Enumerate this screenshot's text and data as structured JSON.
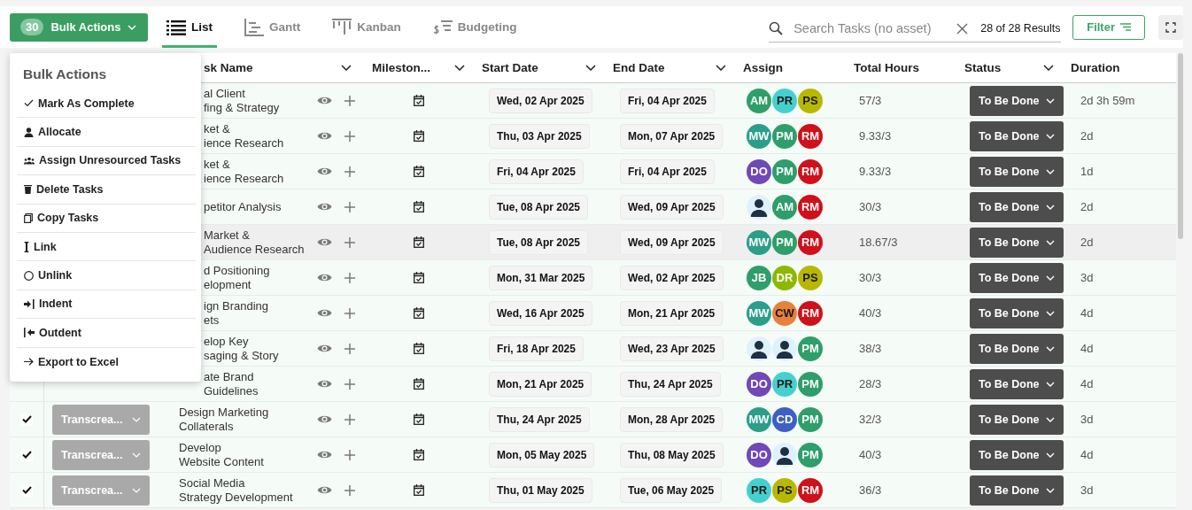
{
  "toolbar": {
    "bulk_actions": {
      "count": "30",
      "label": "Bulk Actions"
    },
    "tabs": [
      {
        "label": "List",
        "selected": true
      },
      {
        "label": "Gantt",
        "selected": false
      },
      {
        "label": "Kanban",
        "selected": false
      },
      {
        "label": "Budgeting",
        "selected": false
      }
    ],
    "search": {
      "placeholder": "Search Tasks (no asset)"
    },
    "results": "28 of 28 Results",
    "filter": "Filter"
  },
  "table": {
    "columns": [
      {
        "label": "sk Name",
        "menu": true
      },
      {
        "label": "Mileston...",
        "menu": true
      },
      {
        "label": "Start Date",
        "menu": true
      },
      {
        "label": "End Date",
        "menu": true
      },
      {
        "label": "Assign",
        "menu": false
      },
      {
        "label": "Total Hours",
        "menu": false
      },
      {
        "label": "Status",
        "menu": true
      },
      {
        "label": "Duration",
        "menu": false
      }
    ],
    "rows": [
      {
        "name": [
          "al Client",
          "fing & Strategy"
        ],
        "start": "Wed, 02 Apr 2025",
        "end": "Fri, 04 Apr 2025",
        "assign": [
          {
            "initials": "AM",
            "color": "#2e9e6a"
          },
          {
            "initials": "PR",
            "color": "#45d0d0"
          },
          {
            "initials": "PS",
            "color": "#b8b800"
          }
        ],
        "hours": "57/3",
        "status": "To Be Done",
        "duration": "2d 3h 59m",
        "highlighted": false
      },
      {
        "name": [
          "ket &",
          "ience Research"
        ],
        "start": "Thu, 03 Apr 2025",
        "end": "Mon, 07 Apr 2025",
        "assign": [
          {
            "initials": "MW",
            "color": "#2b9e8a"
          },
          {
            "initials": "PM",
            "color": "#2e9e6a"
          },
          {
            "initials": "RM",
            "color": "#d0101a"
          }
        ],
        "hours": "9.33/3",
        "status": "To Be Done",
        "duration": "2d",
        "highlighted": false
      },
      {
        "name": [
          "ket &",
          "ience Research"
        ],
        "start": "Fri, 04 Apr 2025",
        "end": "Fri, 04 Apr 2025",
        "assign": [
          {
            "initials": "DO",
            "color": "#7048b8"
          },
          {
            "initials": "PM",
            "color": "#2e9e6a"
          },
          {
            "initials": "RM",
            "color": "#d0101a"
          }
        ],
        "hours": "9.33/3",
        "status": "To Be Done",
        "duration": "1d",
        "highlighted": false
      },
      {
        "name": [
          "petitor Analysis"
        ],
        "start": "Tue, 08 Apr 2025",
        "end": "Wed, 09 Apr 2025",
        "assign": [
          {
            "kind": "placeholder"
          },
          {
            "initials": "AM",
            "color": "#2e9e6a"
          },
          {
            "initials": "RM",
            "color": "#d0101a"
          }
        ],
        "hours": "30/3",
        "status": "To Be Done",
        "duration": "2d",
        "highlighted": false
      },
      {
        "name": [
          "Market &",
          "Audience Research"
        ],
        "start": "Tue, 08 Apr 2025",
        "end": "Wed, 09 Apr 2025",
        "assign": [
          {
            "initials": "MW",
            "color": "#2b9e8a"
          },
          {
            "initials": "PM",
            "color": "#2e9e6a"
          },
          {
            "initials": "RM",
            "color": "#d0101a"
          }
        ],
        "hours": "18.67/3",
        "status": "To Be Done",
        "duration": "2d",
        "highlighted": true
      },
      {
        "name": [
          "d Positioning",
          "elopment"
        ],
        "start": "Mon, 31 Mar 2025",
        "end": "Wed, 02 Apr 2025",
        "assign": [
          {
            "initials": "JB",
            "color": "#2e9e6a"
          },
          {
            "initials": "DR",
            "color": "#8cb800"
          },
          {
            "initials": "PS",
            "color": "#b8b800"
          }
        ],
        "hours": "30/3",
        "status": "To Be Done",
        "duration": "3d",
        "highlighted": false
      },
      {
        "name": [
          "ign Branding",
          "ets"
        ],
        "start": "Wed, 16 Apr 2025",
        "end": "Mon, 21 Apr 2025",
        "assign": [
          {
            "initials": "MW",
            "color": "#2b9e8a"
          },
          {
            "initials": "CW",
            "color": "#e8803c"
          },
          {
            "initials": "RM",
            "color": "#d0101a"
          }
        ],
        "hours": "40/3",
        "status": "To Be Done",
        "duration": "4d",
        "highlighted": false
      },
      {
        "name": [
          "elop Key",
          "saging & Story"
        ],
        "start": "Fri, 18 Apr 2025",
        "end": "Wed, 23 Apr 2025",
        "assign": [
          {
            "kind": "placeholder"
          },
          {
            "kind": "placeholder"
          },
          {
            "initials": "PM",
            "color": "#2e9e6a"
          }
        ],
        "hours": "38/3",
        "status": "To Be Done",
        "duration": "4d",
        "highlighted": false
      },
      {
        "name": [
          "ate Brand",
          "Guidelines"
        ],
        "start": "Mon, 21 Apr 2025",
        "end": "Thu, 24 Apr 2025",
        "assign": [
          {
            "initials": "DO",
            "color": "#7048b8"
          },
          {
            "initials": "PR",
            "color": "#45d0d0"
          },
          {
            "initials": "PM",
            "color": "#2e9e6a"
          }
        ],
        "hours": "28/3",
        "status": "To Be Done",
        "duration": "4d",
        "highlighted": false
      },
      {
        "checked": true,
        "phase": "Transcrea...",
        "name": [
          "Design Marketing",
          "Collaterals"
        ],
        "start": "Thu, 24 Apr 2025",
        "end": "Mon, 28 Apr 2025",
        "assign": [
          {
            "initials": "MW",
            "color": "#2b9e8a"
          },
          {
            "initials": "CD",
            "color": "#3f5fc8"
          },
          {
            "initials": "PM",
            "color": "#2e9e6a"
          }
        ],
        "hours": "32/3",
        "status": "To Be Done",
        "duration": "3d",
        "highlighted": false
      },
      {
        "checked": true,
        "phase": "Transcrea...",
        "name": [
          "Develop",
          "Website Content"
        ],
        "start": "Mon, 05 May 2025",
        "end": "Thu, 08 May 2025",
        "assign": [
          {
            "initials": "DO",
            "color": "#7048b8"
          },
          {
            "kind": "placeholder"
          },
          {
            "initials": "PM",
            "color": "#2e9e6a"
          }
        ],
        "hours": "40/3",
        "status": "To Be Done",
        "duration": "4d",
        "highlighted": false
      },
      {
        "checked": true,
        "phase": "Transcrea...",
        "name": [
          "Social Media",
          "Strategy Development"
        ],
        "start": "Thu, 01 May 2025",
        "end": "Tue, 06 May 2025",
        "assign": [
          {
            "initials": "PR",
            "color": "#45d0d0"
          },
          {
            "initials": "PS",
            "color": "#b8b800"
          },
          {
            "initials": "RM",
            "color": "#d0101a"
          }
        ],
        "hours": "36/3",
        "status": "To Be Done",
        "duration": "3d",
        "highlighted": false
      }
    ]
  },
  "bulk_menu": {
    "title": "Bulk Actions",
    "items": [
      {
        "label": "Mark As Complete",
        "kind": "check"
      },
      {
        "label": "Allocate",
        "kind": "person"
      },
      {
        "label": "Assign Unresourced Tasks",
        "kind": "people"
      },
      {
        "label": "Delete Tasks",
        "kind": "trash"
      },
      {
        "label": "Copy Tasks",
        "kind": "copy"
      },
      {
        "label": "Link",
        "kind": "link"
      },
      {
        "label": "Unlink",
        "kind": "circle"
      },
      {
        "label": "Indent",
        "kind": "indent"
      },
      {
        "label": "Outdent",
        "kind": "outdent"
      },
      {
        "label": "Export to Excel",
        "kind": "arrow"
      }
    ]
  }
}
